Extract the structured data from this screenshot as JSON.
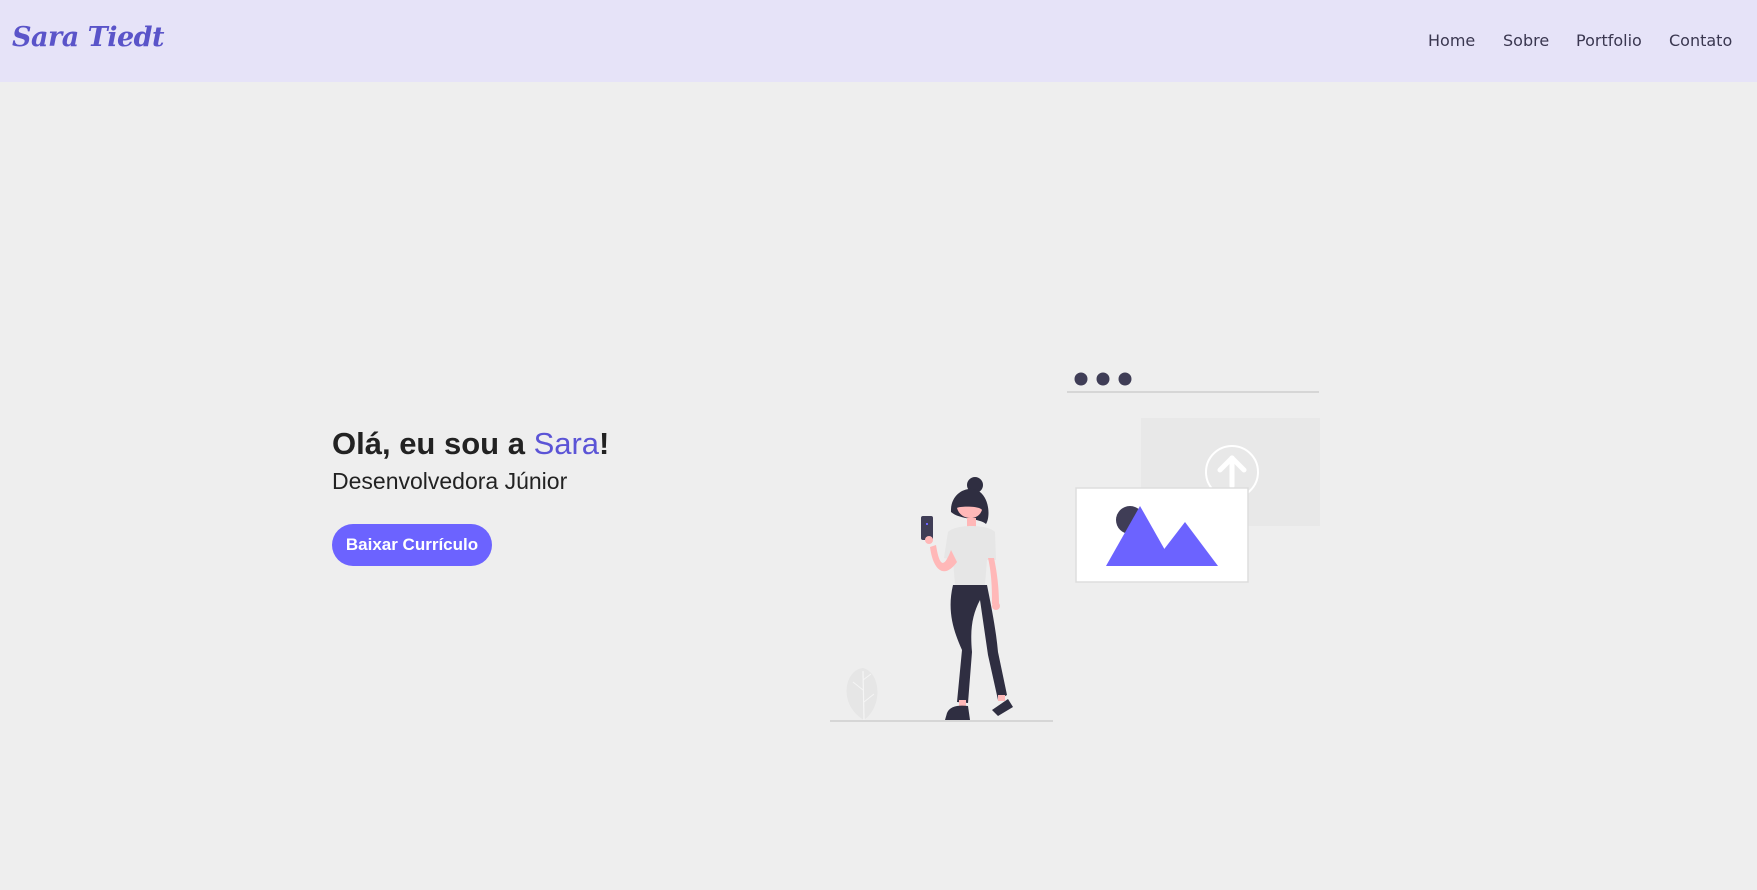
{
  "header": {
    "logo": "Sara Tiedt",
    "nav": [
      "Home",
      "Sobre",
      "Portfolio",
      "Contato"
    ]
  },
  "hero": {
    "title_prefix": "Olá, eu sou a ",
    "title_name": "Sara",
    "title_suffix": "!",
    "subtitle": "Desenvolvedora Júnior",
    "button_label": "Baixar Currículo"
  },
  "colors": {
    "accent": "#6c63ff",
    "header_bg": "#e6e3f8",
    "page_bg": "#eeeeee",
    "text_dark": "#222222"
  },
  "icons": [
    "upload-arrow-icon",
    "image-placeholder-icon",
    "window-dots-icon",
    "leaf-icon"
  ]
}
